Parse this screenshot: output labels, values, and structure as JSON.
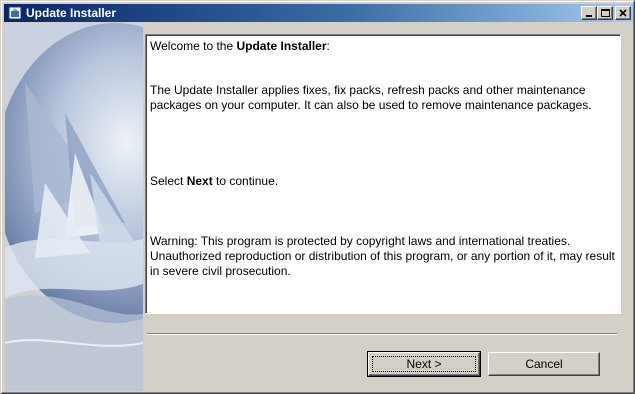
{
  "window": {
    "title": "Update Installer"
  },
  "content": {
    "welcome_prefix": "Welcome to the ",
    "welcome_bold": "Update Installer",
    "welcome_suffix": ":",
    "description": "The Update Installer applies fixes, fix packs, refresh packs and other maintenance packages on your computer. It can also be used to remove maintenance packages.",
    "select_prefix": "Select ",
    "select_bold": "Next",
    "select_suffix": " to continue.",
    "warning": "Warning: This program is protected by copyright laws and international treaties. Unauthorized reproduction or distribution of this program, or any portion of it, may result in severe civil prosecution."
  },
  "buttons": {
    "next_label": "Next >",
    "cancel_label": "Cancel"
  },
  "icons": {
    "title": "installer-icon",
    "minimize": "minimize-icon",
    "maximize": "maximize-icon",
    "close": "close-icon"
  },
  "colors": {
    "titlebar_start": "#0a246a",
    "titlebar_end": "#a6caf0",
    "face": "#d4d0c8"
  }
}
